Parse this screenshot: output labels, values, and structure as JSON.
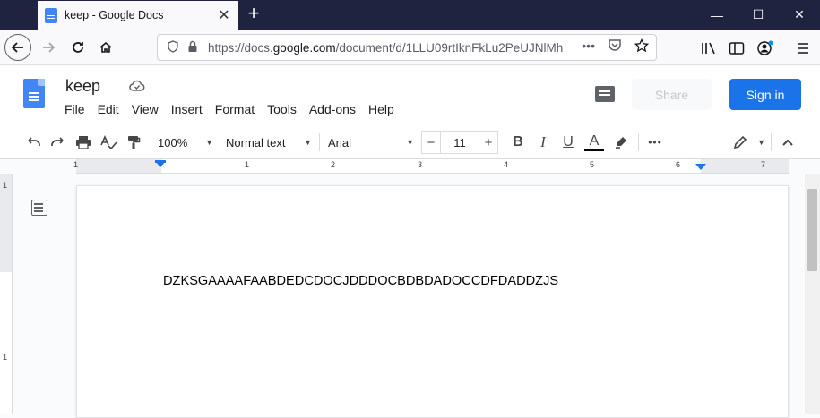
{
  "browser": {
    "tab_title": "keep - Google Docs",
    "tab_close": "✕",
    "new_tab": "+",
    "window_controls": [
      "—",
      "☐",
      "✕"
    ],
    "url_prefix": "https://docs.",
    "url_domain": "google.com",
    "url_path": "/document/d/1LLU09rtIknFkLu2PeUJNlMh",
    "url_more": "•••"
  },
  "docs": {
    "title": "keep",
    "menu": [
      "File",
      "Edit",
      "View",
      "Insert",
      "Format",
      "Tools",
      "Add-ons",
      "Help"
    ],
    "share_label": "Share",
    "signin_label": "Sign in"
  },
  "toolbar": {
    "zoom": "100%",
    "style": "Normal text",
    "font": "Arial",
    "font_size": "11",
    "minus": "−",
    "plus": "+",
    "bold": "B",
    "italic": "I",
    "underline": "U",
    "text_color": "A",
    "more": "•••"
  },
  "ruler": {
    "labels": [
      "1",
      "1",
      "2",
      "3",
      "4",
      "5",
      "6",
      "7"
    ]
  },
  "vruler": {
    "labels": [
      "1",
      "1"
    ]
  },
  "document": {
    "body_text": "DZKSGAAAAFAABDEDCDOCJDDDOCBDBDADOCCDFDADDZJS"
  },
  "colors": {
    "brand_blue": "#1a73e8",
    "docs_blue": "#4285f4",
    "tabstrip": "#202340"
  }
}
